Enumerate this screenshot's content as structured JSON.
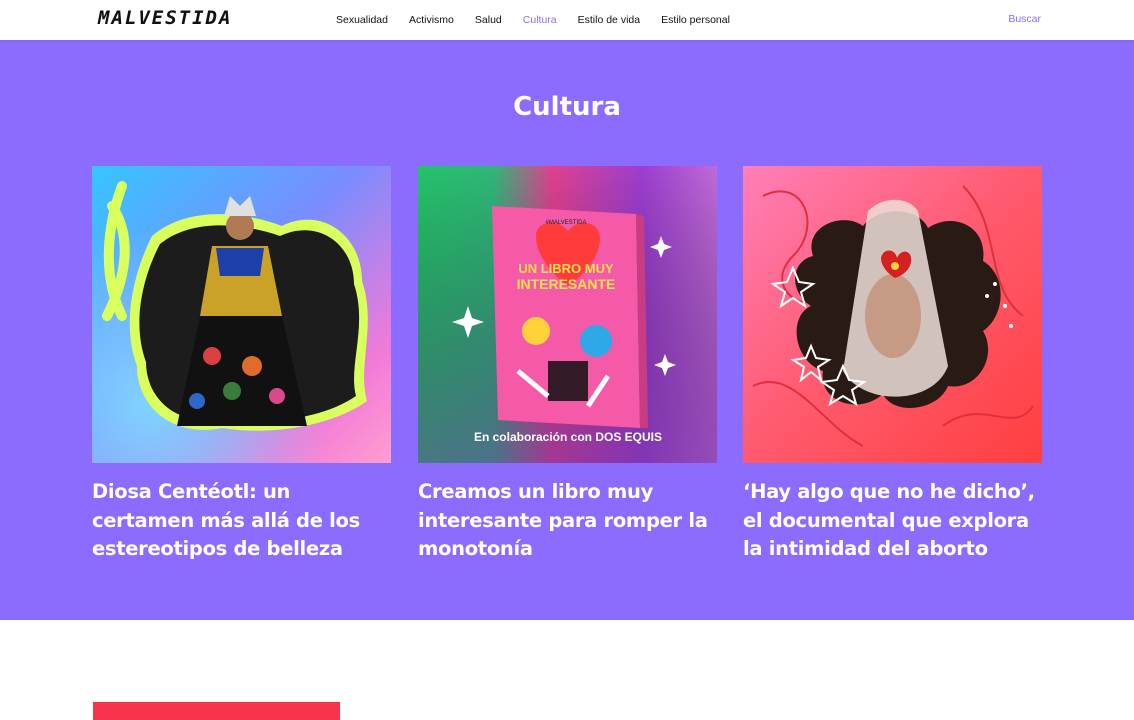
{
  "header": {
    "logo": "MALVESTIDA",
    "nav": [
      {
        "label": "Sexualidad",
        "active": false
      },
      {
        "label": "Activismo",
        "active": false
      },
      {
        "label": "Salud",
        "active": false
      },
      {
        "label": "Cultura",
        "active": true
      },
      {
        "label": "Estilo de vida",
        "active": false
      },
      {
        "label": "Estilo personal",
        "active": false
      }
    ],
    "search_label": "Buscar"
  },
  "section": {
    "title": "Cultura",
    "articles": [
      {
        "title": "Diosa Centéotl: un certamen más allá de los estereotipos de belleza"
      },
      {
        "title": "Creamos un libro muy interesante para romper la monotonía",
        "image_book_title": "UN LIBRO MUY INTERESANTE",
        "image_book_brand": "#MALVESTIDA",
        "image_caption": "En colaboración con",
        "image_caption_brand": "DOS EQUIS"
      },
      {
        "title": "‘Hay algo que no he dicho’, el documental que explora la intimidad del aborto"
      }
    ]
  },
  "colors": {
    "accent": "#8c6cff",
    "section_bg": "#8c6cff",
    "red_block": "#f7334d"
  }
}
